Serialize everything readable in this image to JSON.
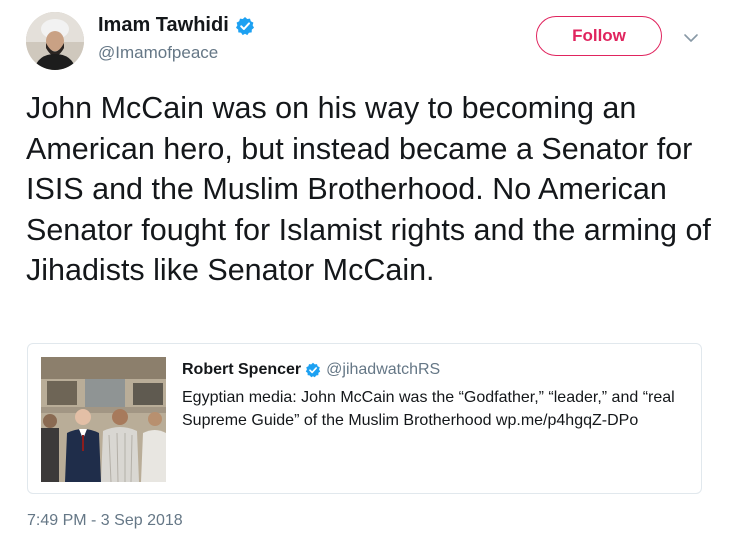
{
  "header": {
    "display_name": "Imam Tawhidi",
    "handle": "@Imamofpeace",
    "follow_label": "Follow"
  },
  "tweet": {
    "text": "John McCain was on his way to becoming an American hero, but instead became a Senator for ISIS and the Muslim Brotherhood. No American Senator fought for Islamist rights and the arming of Jihadists like Senator McCain.",
    "timestamp": "7:49 PM - 3 Sep 2018"
  },
  "quote": {
    "display_name": "Robert Spencer",
    "handle": "@jihadwatchRS",
    "text": "Egyptian media: John McCain was the “Godfather,” “leader,” and “real Supreme Guide” of the Muslim Brotherhood wp.me/p4hgqZ-DPo"
  },
  "icons": {
    "verified": "verified-badge-icon",
    "caret": "chevron-down-icon"
  },
  "colors": {
    "follow_accent": "#e0245e",
    "verified_blue": "#1da1f2",
    "secondary_text": "#657786",
    "card_border": "#e1e8ed"
  }
}
